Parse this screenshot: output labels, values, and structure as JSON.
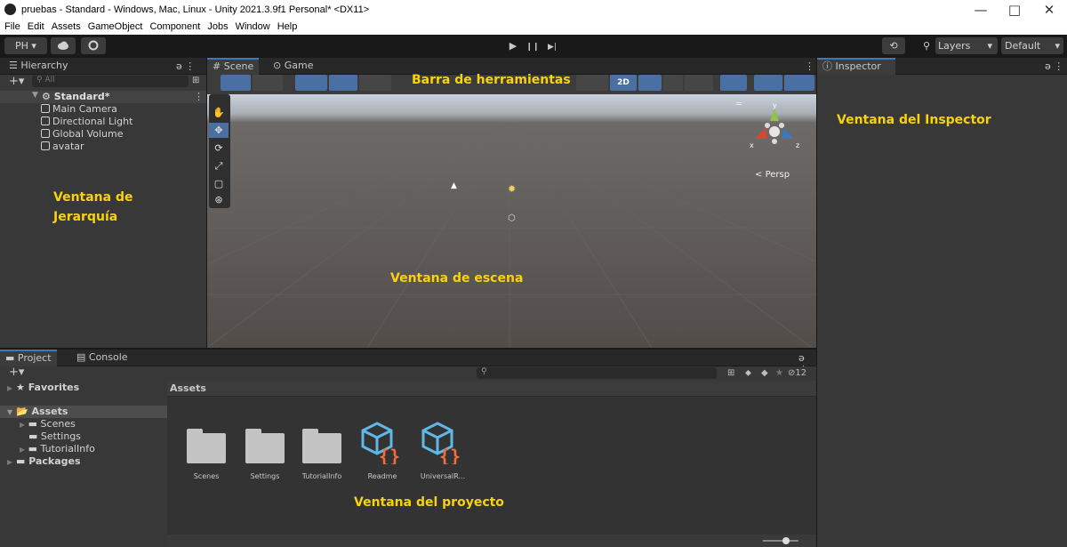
{
  "window": {
    "title": "pruebas - Standard - Windows, Mac, Linux - Unity 2021.3.9f1 Personal* <DX11>",
    "controls": {
      "minimize": "—",
      "maximize": "□",
      "close": "✕"
    }
  },
  "menu": [
    "File",
    "Edit",
    "Assets",
    "GameObject",
    "Component",
    "Jobs",
    "Window",
    "Help"
  ],
  "toolbar": {
    "account": "PH ▾",
    "play": "▶",
    "pause": "❙❙",
    "step": "▶|",
    "history_icon": "⟲",
    "search_icon": "⚲",
    "layers": "Layers",
    "layout": "Default"
  },
  "hierarchy": {
    "tab": "Hierarchy",
    "search_placeholder": "All",
    "scene": "Standard*",
    "items": [
      "Main Camera",
      "Directional Light",
      "Global Volume",
      "avatar"
    ]
  },
  "scene_view": {
    "tabs": [
      "Scene",
      "Game"
    ],
    "button_2d": "2D",
    "persp": "Persp",
    "gizmo_axes": {
      "x": "x",
      "y": "y",
      "z": "z"
    },
    "colors": {
      "x": "#d9472b",
      "y": "#8ec63f",
      "z": "#3a79bb"
    }
  },
  "inspector": {
    "tab": "Inspector"
  },
  "project": {
    "tabs": [
      "Project",
      "Console"
    ],
    "favorites": "Favorites",
    "assets_root": "Assets",
    "assets_children": [
      "Scenes",
      "Settings",
      "TutorialInfo"
    ],
    "packages": "Packages",
    "breadcrumb": "Assets",
    "hidden_count": "12",
    "assets": [
      {
        "name": "Scenes",
        "type": "folder"
      },
      {
        "name": "Settings",
        "type": "folder"
      },
      {
        "name": "TutorialInfo",
        "type": "folder"
      },
      {
        "name": "Readme",
        "type": "package"
      },
      {
        "name": "UniversalR...",
        "type": "package"
      }
    ]
  },
  "annotations": {
    "toolbar": "Barra de herramientas",
    "inspector": "Ventana del Inspector",
    "hierarchy_line1": "Ventana de",
    "hierarchy_line2": "Jerarquía",
    "scene": "Ventana de escena",
    "project": "Ventana del proyecto"
  },
  "theme": {
    "accent": "#3a79bb",
    "annotation": "#f9d20b"
  }
}
